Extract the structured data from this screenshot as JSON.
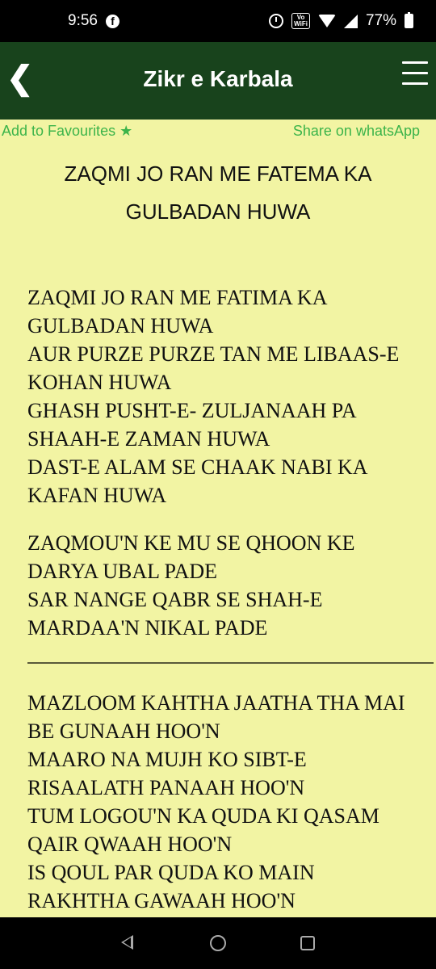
{
  "status_bar": {
    "time": "9:56",
    "battery": "77%",
    "vowifi_top": "Vo",
    "vowifi_bottom": "WiFi"
  },
  "app_bar": {
    "title": "Zikr e Karbala",
    "back_glyph": "❮"
  },
  "actions": {
    "favourites": "Add to Favourites ★",
    "share": "Share on whatsApp"
  },
  "song": {
    "title_line1": "ZAQMI JO RAN ME FATEMA KA",
    "title_line2": "GULBADAN HUWA"
  },
  "stanzas": [
    [
      "ZAQMI JO RAN ME FATIMA KA",
      "GULBADAN HUWA",
      "AUR PURZE PURZE TAN ME LIBAAS-E",
      "KOHAN HUWA",
      "GHASH PUSHT-E- ZULJANAAH PA",
      "SHAAH-E ZAMAN HUWA",
      "DAST-E ALAM SE CHAAK NABI KA",
      "KAFAN HUWA"
    ],
    [
      "ZAQMOU'N KE MU SE QHOON KE",
      "DARYA UBAL PADE",
      "SAR NANGE QABR SE SHAH-E",
      "MARDAA'N NIKAL PADE"
    ],
    [
      "MAZLOOM KAHTHA JAATHA THA MAI",
      "BE GUNAAH HOO'N",
      "MAARO NA MUJH KO SIBT-E",
      "RISAALATH PANAAH HOO'N",
      "TUM LOGOU'N KA QUDA KI QASAM",
      "QAIR QWAAH HOO'N",
      "IS QOUL PAR QUDA KO MAIN",
      "RAKHTHA GAWAAH HOO'N"
    ]
  ]
}
